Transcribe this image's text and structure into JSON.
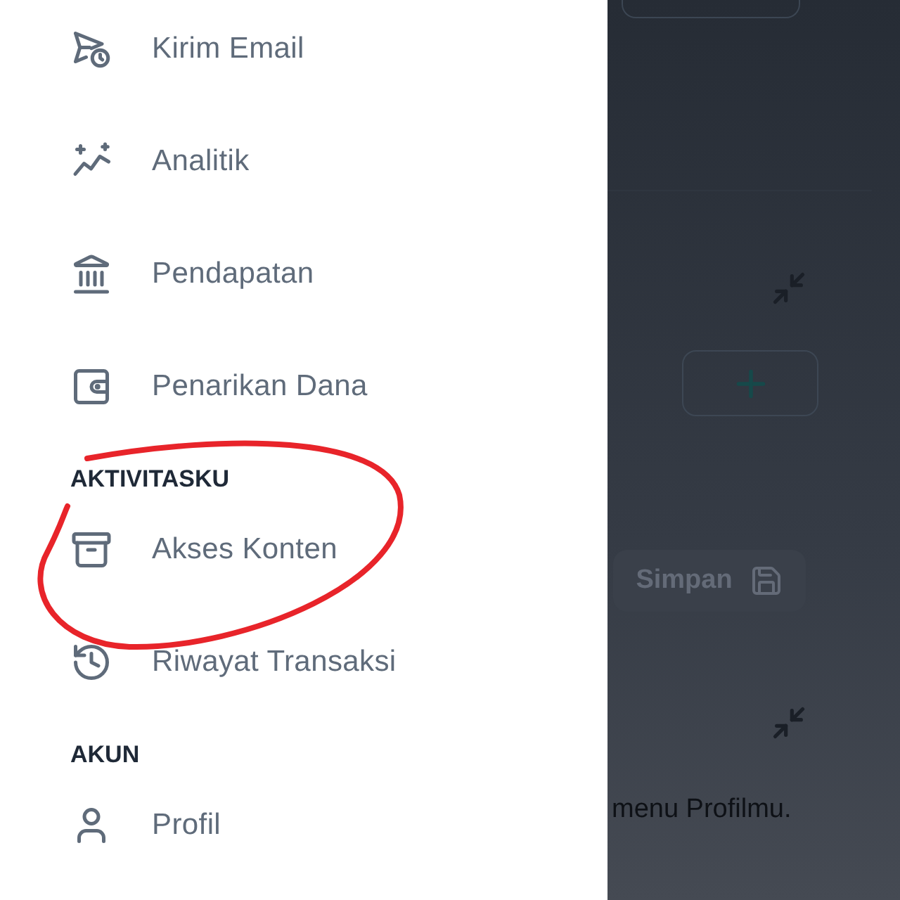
{
  "sidebar": {
    "sections": [
      {
        "items": [
          {
            "label": "Kirim Email"
          },
          {
            "label": "Analitik"
          },
          {
            "label": "Pendapatan"
          },
          {
            "label": "Penarikan Dana"
          }
        ]
      },
      {
        "heading": "AKTIVITASKU",
        "items": [
          {
            "label": "Akses Konten"
          },
          {
            "label": "Riwayat Transaksi"
          }
        ]
      },
      {
        "heading": "AKUN",
        "items": [
          {
            "label": "Profil"
          }
        ]
      }
    ]
  },
  "background_page": {
    "save_button": "Simpan",
    "note": "menu Profilmu."
  }
}
